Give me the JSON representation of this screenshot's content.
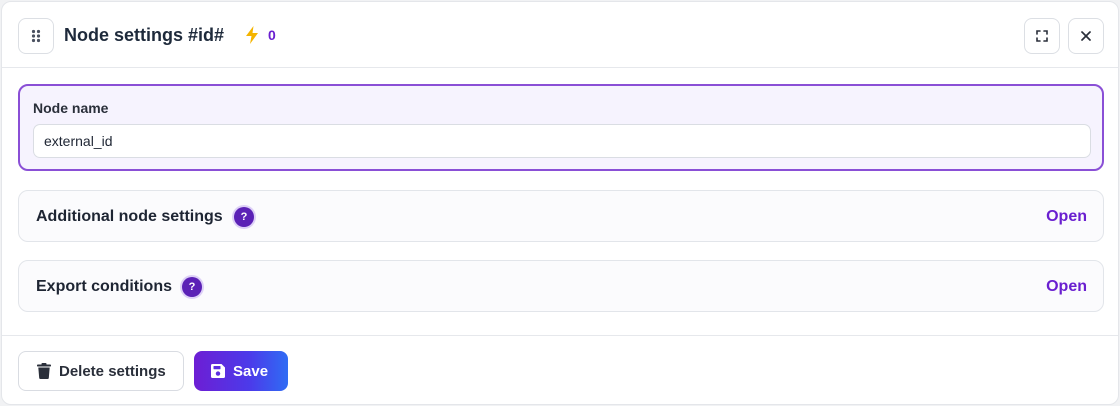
{
  "header": {
    "title": "Node settings #id#",
    "trigger_count": "0",
    "icons": {
      "drag": "drag-handle-icon",
      "bolt": "lightning-bolt-icon",
      "expand": "fullscreen-icon",
      "close": "close-icon"
    }
  },
  "node_name": {
    "label": "Node name",
    "value": "external_id"
  },
  "sections": [
    {
      "label": "Additional node settings",
      "help": "?",
      "action": "Open"
    },
    {
      "label": "Export conditions",
      "help": "?",
      "action": "Open"
    }
  ],
  "footer": {
    "delete_label": "Delete settings",
    "save_label": "Save",
    "icons": {
      "delete": "trash-icon",
      "save": "floppy-disk-icon"
    }
  },
  "colors": {
    "accent": "#6a1fd0",
    "focus_border": "#8a4fd6",
    "save_gradient_start": "#6d1ed4",
    "save_gradient_end": "#2f6cf4"
  }
}
